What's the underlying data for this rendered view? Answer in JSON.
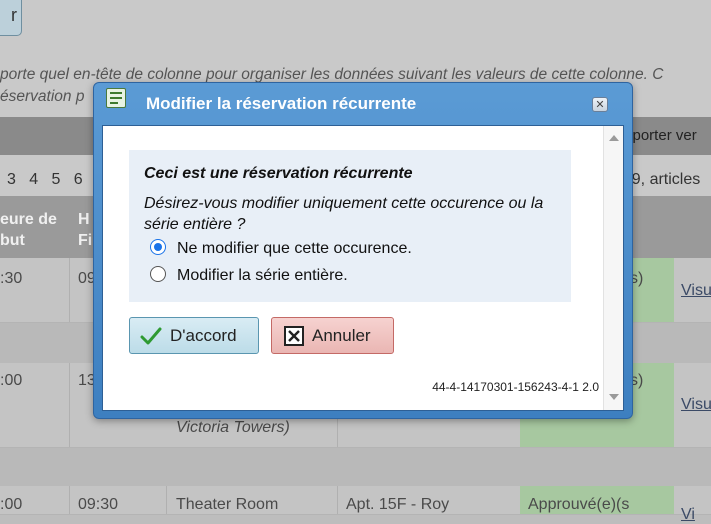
{
  "background": {
    "top_button_label": "r",
    "hint_line1": "porte quel en-tête de colonne pour organiser les données suivant les valeurs de cette colonne. C",
    "hint_line2": "éservation p",
    "export_label": "xporter ver",
    "pager_numbers": [
      "3",
      "4",
      "5",
      "6"
    ],
    "pager_info": "r 9, articles",
    "columns": {
      "heure_debut_line1": "eure de",
      "heure_debut_line2": "but",
      "heure_fin_line1": "H",
      "heure_fin_line2": "Fi"
    },
    "rows": [
      {
        "start": ":30",
        "end": "09",
        "status": "s)",
        "link": "Visu"
      },
      {
        "start": ":00",
        "end": "13",
        "room_tail": "Victoria Towers)",
        "status": "s)",
        "link": "Visu"
      },
      {
        "start": ":00",
        "end": "09:30",
        "room": "Theater Room",
        "unit": "Apt. 15F - Roy",
        "status": "Approuvé(e)(s",
        "link": "Vi"
      }
    ]
  },
  "dialog": {
    "title": "Modifier la réservation récurrente",
    "close_icon": "close-icon",
    "question_title": "Ceci est une réservation récurrente",
    "question_text": "Désirez-vous modifier uniquement cette occurence ou la série entière ?",
    "options": [
      {
        "label": "Ne modifier que cette occurence.",
        "selected": true
      },
      {
        "label": "Modifier la série entière.",
        "selected": false
      }
    ],
    "ok_label": "D'accord",
    "cancel_label": "Annuler",
    "version": "44-4-14170301-156243-4-1 2.0"
  },
  "colors": {
    "dialog_header": "#4a8ccc",
    "ok_button": "#c8e4ef",
    "cancel_button": "#f0c4c2",
    "radio_selected": "#1a73e8",
    "approved_cell": "#a7c8a0"
  }
}
